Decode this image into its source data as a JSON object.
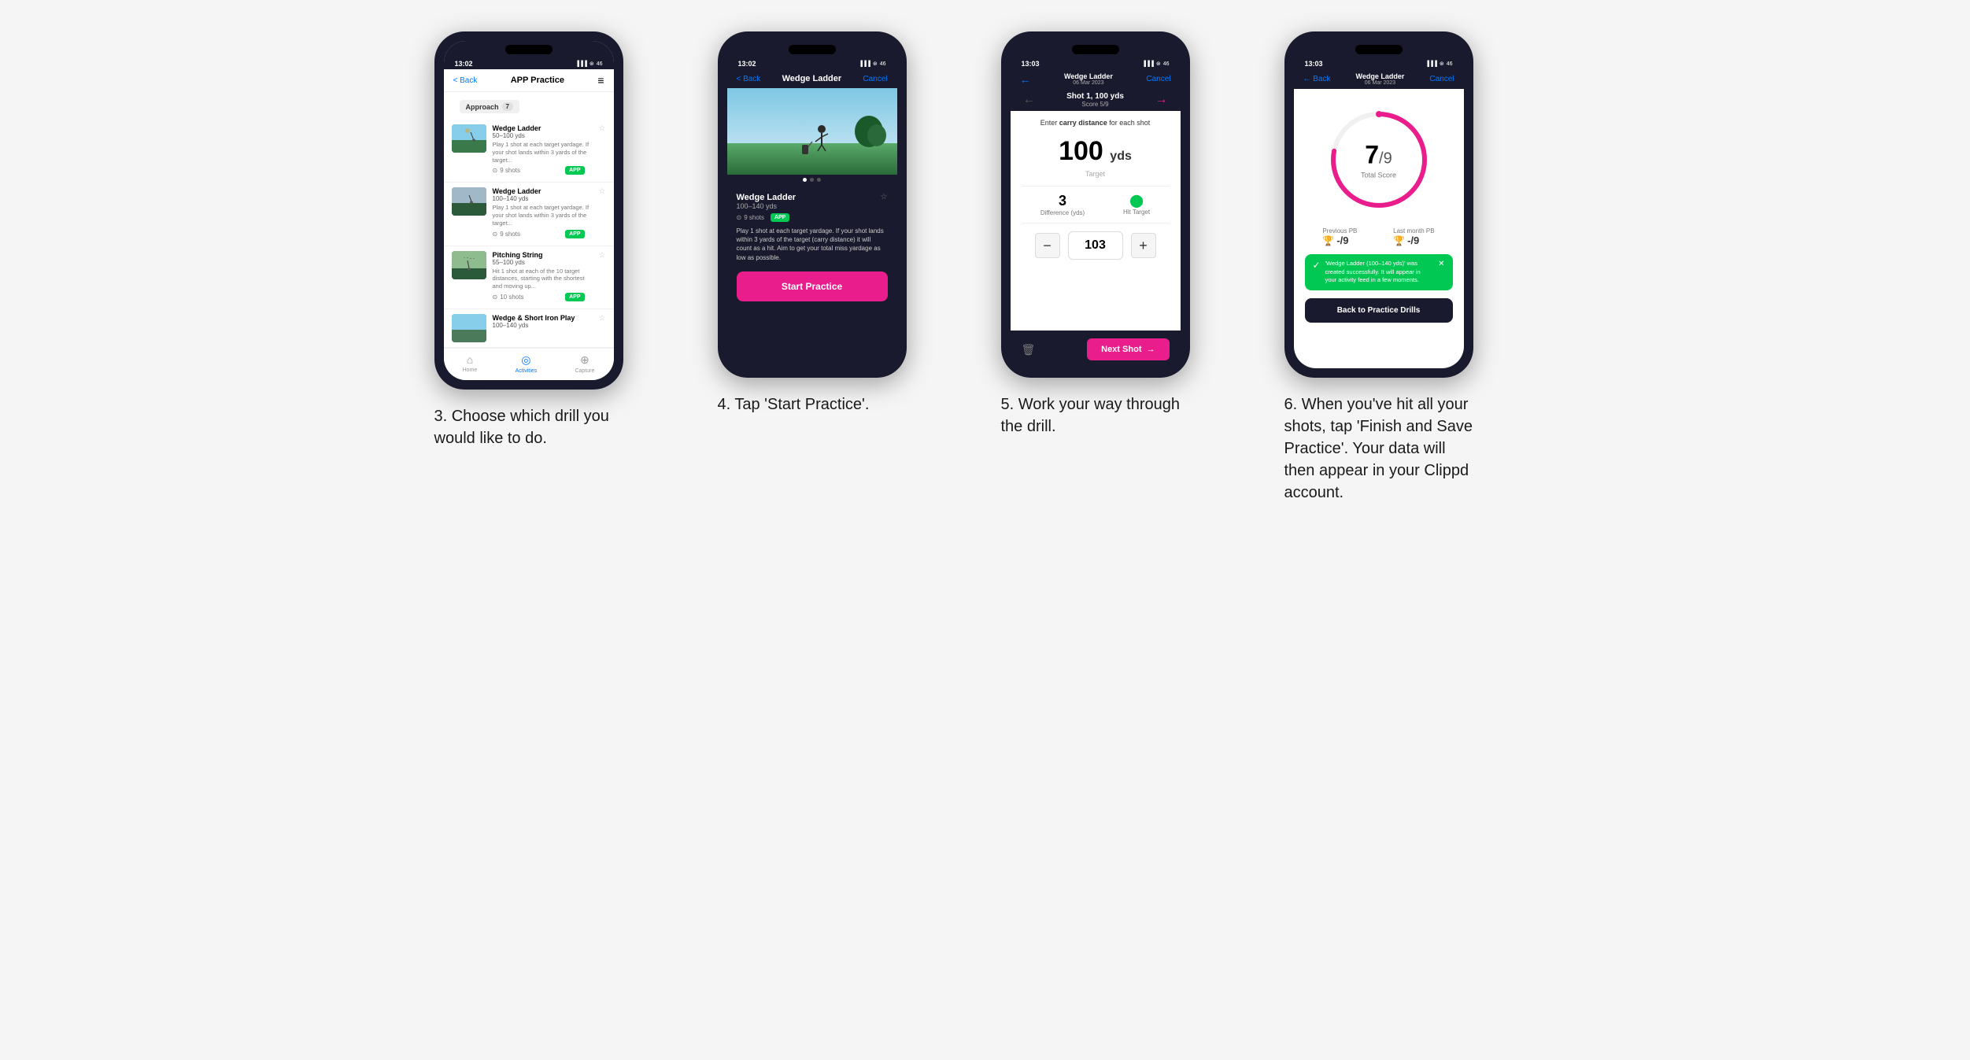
{
  "steps": [
    {
      "number": "3",
      "caption": "3. Choose which drill you would like to do.",
      "phone": {
        "time": "13:02",
        "nav": {
          "back": "< Back",
          "title": "APP Practice",
          "menu": "≡"
        },
        "section": "Approach",
        "section_count": "7",
        "drills": [
          {
            "name": "Wedge Ladder",
            "yds": "50–100 yds",
            "desc": "Play 1 shot at each target yardage. If your shot lands within 3 yards of the target...",
            "shots": "9 shots",
            "badge": "APP"
          },
          {
            "name": "Wedge Ladder",
            "yds": "100–140 yds",
            "desc": "Play 1 shot at each target yardage. If your shot lands within 3 yards of the target...",
            "shots": "9 shots",
            "badge": "APP"
          },
          {
            "name": "Pitching String",
            "yds": "55–100 yds",
            "desc": "Hit 1 shot at each of the 10 target distances, starting with the shortest and moving up...",
            "shots": "10 shots",
            "badge": "APP"
          },
          {
            "name": "Wedge & Short Iron Play",
            "yds": "100–140 yds",
            "desc": "",
            "shots": "",
            "badge": ""
          }
        ],
        "bottom_nav": [
          {
            "icon": "⌂",
            "label": "Home",
            "active": false
          },
          {
            "icon": "◎",
            "label": "Activities",
            "active": true
          },
          {
            "icon": "+",
            "label": "Capture",
            "active": false
          }
        ]
      }
    },
    {
      "number": "4",
      "caption": "4. Tap 'Start Practice'.",
      "phone": {
        "time": "13:02",
        "nav": {
          "back": "< Back",
          "title": "Wedge Ladder",
          "cancel": "Cancel"
        },
        "drill_name": "Wedge Ladder",
        "drill_yds": "100–140 yds",
        "shots": "9 shots",
        "badge": "APP",
        "description": "Play 1 shot at each target yardage. If your shot lands within 3 yards of the target (carry distance) it will count as a hit. Aim to get your total miss yardage as low as possible.",
        "start_button": "Start Practice"
      }
    },
    {
      "number": "5",
      "caption": "5. Work your way through the drill.",
      "phone": {
        "time": "13:03",
        "nav": {
          "back_label": "Wedge Ladder",
          "back_date": "06 Mar 2023",
          "cancel": "Cancel"
        },
        "shot_label": "Shot 1, 100 yds",
        "score": "Score 5/9",
        "carry_instruction": "Enter carry distance for each shot",
        "target_yds": "100",
        "target_unit": "yds",
        "target_label": "Target",
        "difference": "3",
        "difference_label": "Difference (yds)",
        "hit_target_label": "Hit Target",
        "current_value": "103",
        "next_shot_label": "Next Shot"
      }
    },
    {
      "number": "6",
      "caption": "6. When you've hit all your shots, tap 'Finish and Save Practice'. Your data will then appear in your Clippd account.",
      "phone": {
        "time": "13:03",
        "nav": {
          "back_label": "Wedge Ladder",
          "back_date": "06 Mar 2023",
          "cancel": "Cancel"
        },
        "score_num": "7",
        "score_denom": "/9",
        "total_score_label": "Total Score",
        "previous_pb_label": "Previous PB",
        "previous_pb_val": "-/9",
        "last_month_pb_label": "Last month PB",
        "last_month_pb_val": "-/9",
        "success_message": "'Wedge Ladder (100–140 yds)' was created successfully. It will appear in your activity feed in a few moments.",
        "back_button": "Back to Practice Drills"
      }
    }
  ]
}
